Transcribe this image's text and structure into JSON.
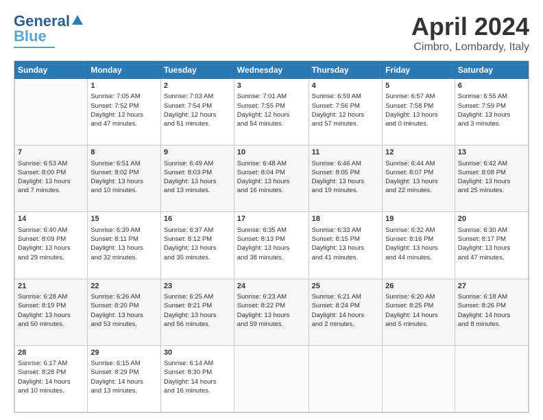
{
  "header": {
    "logo_line1": "General",
    "logo_line2": "Blue",
    "title": "April 2024",
    "subtitle": "Cimbro, Lombardy, Italy"
  },
  "calendar": {
    "days_of_week": [
      "Sunday",
      "Monday",
      "Tuesday",
      "Wednesday",
      "Thursday",
      "Friday",
      "Saturday"
    ],
    "weeks": [
      [
        {
          "day": "",
          "content": ""
        },
        {
          "day": "1",
          "content": "Sunrise: 7:05 AM\nSunset: 7:52 PM\nDaylight: 12 hours\nand 47 minutes."
        },
        {
          "day": "2",
          "content": "Sunrise: 7:03 AM\nSunset: 7:54 PM\nDaylight: 12 hours\nand 51 minutes."
        },
        {
          "day": "3",
          "content": "Sunrise: 7:01 AM\nSunset: 7:55 PM\nDaylight: 12 hours\nand 54 minutes."
        },
        {
          "day": "4",
          "content": "Sunrise: 6:59 AM\nSunset: 7:56 PM\nDaylight: 12 hours\nand 57 minutes."
        },
        {
          "day": "5",
          "content": "Sunrise: 6:57 AM\nSunset: 7:58 PM\nDaylight: 13 hours\nand 0 minutes."
        },
        {
          "day": "6",
          "content": "Sunrise: 6:55 AM\nSunset: 7:59 PM\nDaylight: 13 hours\nand 3 minutes."
        }
      ],
      [
        {
          "day": "7",
          "content": "Sunrise: 6:53 AM\nSunset: 8:00 PM\nDaylight: 13 hours\nand 7 minutes."
        },
        {
          "day": "8",
          "content": "Sunrise: 6:51 AM\nSunset: 8:02 PM\nDaylight: 13 hours\nand 10 minutes."
        },
        {
          "day": "9",
          "content": "Sunrise: 6:49 AM\nSunset: 8:03 PM\nDaylight: 13 hours\nand 13 minutes."
        },
        {
          "day": "10",
          "content": "Sunrise: 6:48 AM\nSunset: 8:04 PM\nDaylight: 13 hours\nand 16 minutes."
        },
        {
          "day": "11",
          "content": "Sunrise: 6:46 AM\nSunset: 8:05 PM\nDaylight: 13 hours\nand 19 minutes."
        },
        {
          "day": "12",
          "content": "Sunrise: 6:44 AM\nSunset: 8:07 PM\nDaylight: 13 hours\nand 22 minutes."
        },
        {
          "day": "13",
          "content": "Sunrise: 6:42 AM\nSunset: 8:08 PM\nDaylight: 13 hours\nand 25 minutes."
        }
      ],
      [
        {
          "day": "14",
          "content": "Sunrise: 6:40 AM\nSunset: 8:09 PM\nDaylight: 13 hours\nand 29 minutes."
        },
        {
          "day": "15",
          "content": "Sunrise: 6:39 AM\nSunset: 8:11 PM\nDaylight: 13 hours\nand 32 minutes."
        },
        {
          "day": "16",
          "content": "Sunrise: 6:37 AM\nSunset: 8:12 PM\nDaylight: 13 hours\nand 35 minutes."
        },
        {
          "day": "17",
          "content": "Sunrise: 6:35 AM\nSunset: 8:13 PM\nDaylight: 13 hours\nand 38 minutes."
        },
        {
          "day": "18",
          "content": "Sunrise: 6:33 AM\nSunset: 8:15 PM\nDaylight: 13 hours\nand 41 minutes."
        },
        {
          "day": "19",
          "content": "Sunrise: 6:32 AM\nSunset: 8:16 PM\nDaylight: 13 hours\nand 44 minutes."
        },
        {
          "day": "20",
          "content": "Sunrise: 6:30 AM\nSunset: 8:17 PM\nDaylight: 13 hours\nand 47 minutes."
        }
      ],
      [
        {
          "day": "21",
          "content": "Sunrise: 6:28 AM\nSunset: 8:19 PM\nDaylight: 13 hours\nand 50 minutes."
        },
        {
          "day": "22",
          "content": "Sunrise: 6:26 AM\nSunset: 8:20 PM\nDaylight: 13 hours\nand 53 minutes."
        },
        {
          "day": "23",
          "content": "Sunrise: 6:25 AM\nSunset: 8:21 PM\nDaylight: 13 hours\nand 56 minutes."
        },
        {
          "day": "24",
          "content": "Sunrise: 6:23 AM\nSunset: 8:22 PM\nDaylight: 13 hours\nand 59 minutes."
        },
        {
          "day": "25",
          "content": "Sunrise: 6:21 AM\nSunset: 8:24 PM\nDaylight: 14 hours\nand 2 minutes."
        },
        {
          "day": "26",
          "content": "Sunrise: 6:20 AM\nSunset: 8:25 PM\nDaylight: 14 hours\nand 5 minutes."
        },
        {
          "day": "27",
          "content": "Sunrise: 6:18 AM\nSunset: 8:26 PM\nDaylight: 14 hours\nand 8 minutes."
        }
      ],
      [
        {
          "day": "28",
          "content": "Sunrise: 6:17 AM\nSunset: 8:28 PM\nDaylight: 14 hours\nand 10 minutes."
        },
        {
          "day": "29",
          "content": "Sunrise: 6:15 AM\nSunset: 8:29 PM\nDaylight: 14 hours\nand 13 minutes."
        },
        {
          "day": "30",
          "content": "Sunrise: 6:14 AM\nSunset: 8:30 PM\nDaylight: 14 hours\nand 16 minutes."
        },
        {
          "day": "",
          "content": ""
        },
        {
          "day": "",
          "content": ""
        },
        {
          "day": "",
          "content": ""
        },
        {
          "day": "",
          "content": ""
        }
      ]
    ]
  }
}
